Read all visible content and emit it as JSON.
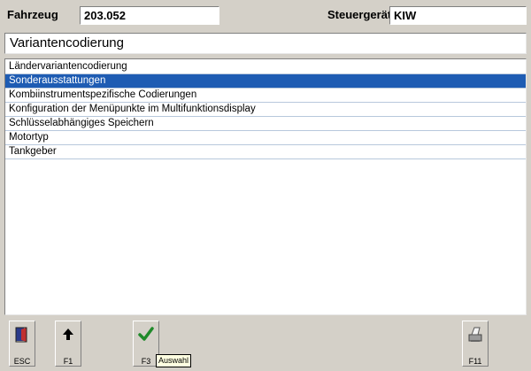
{
  "header": {
    "vehicle_label": "Fahrzeug",
    "vehicle_value": "203.052",
    "ecu_label": "Steuergerät",
    "ecu_value": "KIW"
  },
  "title": "Variantencodierung",
  "list": {
    "items": [
      "Ländervariantencodierung",
      "Sonderausstattungen",
      "Kombiinstrumentspezifische Codierungen",
      "Konfiguration der Menüpunkte im Multifunktionsdisplay",
      "Schlüsselabhängiges Speichern",
      "Motortyp",
      "Tankgeber"
    ],
    "selected_index": 1
  },
  "toolbar": {
    "esc_label": "ESC",
    "f1_label": "F1",
    "f3_label": "F3",
    "f11_label": "F11",
    "tooltip": "Auswahl"
  },
  "colors": {
    "selection": "#1e5cb3",
    "window_bg": "#d4d0c8"
  }
}
